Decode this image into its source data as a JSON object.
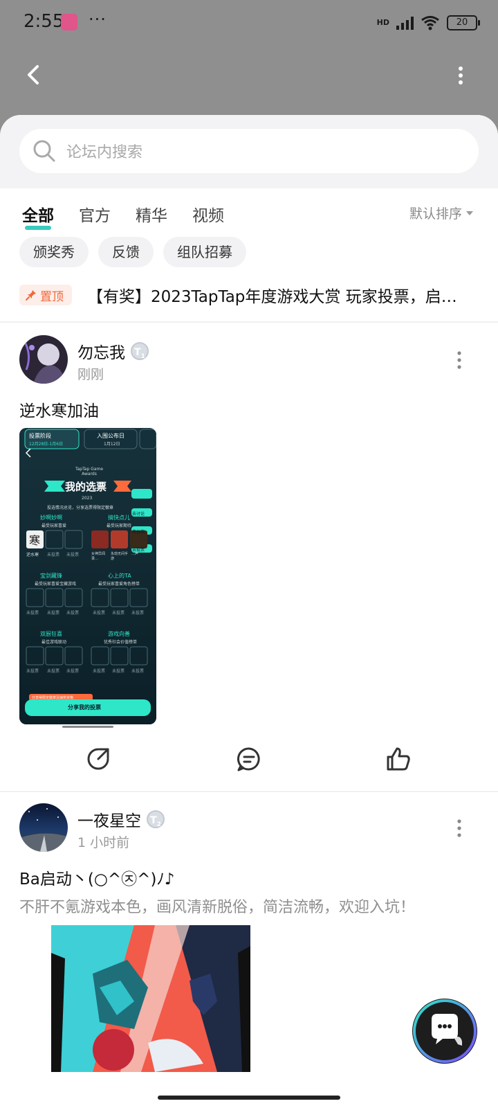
{
  "status": {
    "time": "2:55",
    "network": "HD",
    "battery": "20"
  },
  "search": {
    "placeholder": "论坛内搜索"
  },
  "tabs": [
    {
      "label": "全部",
      "active": true
    },
    {
      "label": "官方",
      "active": false
    },
    {
      "label": "精华",
      "active": false
    },
    {
      "label": "视频",
      "active": false
    }
  ],
  "sort": {
    "label": "默认排序"
  },
  "chips": [
    "颁奖秀",
    "反馈",
    "组队招募"
  ],
  "pinned": {
    "badge": "置顶",
    "title": "【有奖】2023TapTap年度游戏大赏 玩家投票，启…"
  },
  "posts": [
    {
      "user": "勿忘我",
      "level": "1",
      "time": "刚刚",
      "text": "逆水寒加油",
      "image": {
        "tab_left": "投票阶段",
        "tab_left_sub": "12月28日-1月6日",
        "tab_right": "入围公布日",
        "tab_right_sub": "1月12日",
        "brand": "TapTap Game Awards",
        "title": "我的选票",
        "year": "2023",
        "hint": "投选情况总览，分享选票得限定徽章",
        "side_buttons": [
          "去讨论",
          "去抽奖",
          "去投票"
        ],
        "sections": [
          {
            "title": "妙啊妙啊",
            "sub": "最受玩家喜爱",
            "slots": [
              "逆水寒",
              "未投票",
              "未投票"
            ]
          },
          {
            "title": "搞快点儿",
            "sub": "最受玩家期待",
            "slots": [
              "女神异闻录…",
              "永劫无间手游",
              "…声"
            ]
          },
          {
            "title": "宝剑藏锋",
            "sub": "最受玩家喜爱宝藏游戏",
            "slots": [
              "未投票",
              "未投票",
              "未投票"
            ]
          },
          {
            "title": "心上的TA",
            "sub": "最受玩家喜爱角色榜单",
            "slots": [
              "未投票",
              "未投票",
              "未投票"
            ]
          },
          {
            "title": "双厨狂喜",
            "sub": "最佳游戏联动",
            "slots": [
              "未投票",
              "未投票",
              "未投票"
            ]
          },
          {
            "title": "游戏向善",
            "sub": "优秀社会价值榜单",
            "slots": [
              "未投票",
              "未投票",
              "未投票"
            ]
          }
        ],
        "footer_badge": "分享得限定徽章及抽奖资格",
        "share_button": "分享我的投票"
      }
    },
    {
      "user": "一夜星空",
      "level": "2",
      "time": "1 小时前",
      "text": "Ba启动丶(○^㉨^)ﾉ♪",
      "subtext": "不肝不氪游戏本色，画风清新脱俗，简洁流畅，欢迎入坑！"
    }
  ],
  "colors": {
    "accent": "#16c2b3",
    "pin": "#f2683b",
    "image_teal": "#2ee6c8"
  }
}
